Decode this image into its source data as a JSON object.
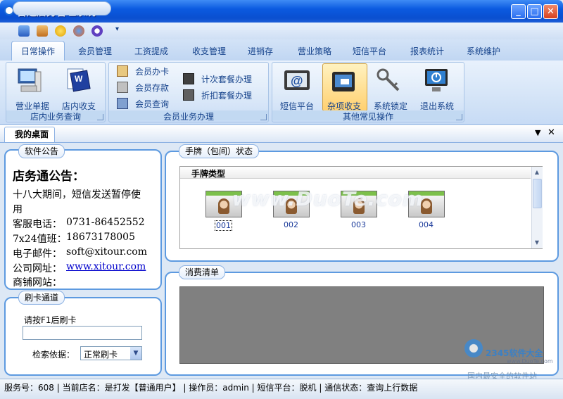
{
  "window": {
    "title": "喜途店务管理系统",
    "min": "_",
    "max": "□",
    "close": "✕"
  },
  "qat_icons": [
    "book-icon",
    "pen-icon",
    "smile-icon",
    "firefox-icon",
    "circle-icon"
  ],
  "tabs": [
    "日常操作",
    "会员管理",
    "工资提成",
    "收支管理",
    "进销存",
    "营业策略",
    "短信平台",
    "报表统计",
    "系统维护"
  ],
  "ribbon": {
    "group1": {
      "label": "店内业务查询",
      "buttons": [
        "营业单据",
        "店内收支"
      ]
    },
    "group2": {
      "label": "会员业务办理",
      "col1": [
        "会员办卡",
        "会员存款",
        "会员查询"
      ],
      "col2": [
        "计次套餐办理",
        "折扣套餐办理"
      ]
    },
    "group3": {
      "label": "其他常见操作",
      "buttons": [
        "短信平台",
        "杂项收支",
        "系统锁定",
        "退出系统"
      ]
    }
  },
  "desk_tab": "我的桌面",
  "notice_panel": {
    "title": "软件公告",
    "heading": "店务通公告：",
    "line1": "十八大期间，短信发送暂停使",
    "line2": "用",
    "phone_label": "客服电话：",
    "phone": "0731-86452552",
    "duty_label": "7x24值班：",
    "duty": "18673178005",
    "email_label": "电子邮件：",
    "email": "soft@xitour.com",
    "site_label": "公司网址：",
    "site": "www.xitour.com",
    "shop_label": "商铺网站："
  },
  "card_panel": {
    "title": "刷卡通道",
    "prompt": "请按F1后刷卡",
    "input_value": "",
    "search_label": "检索依据：",
    "search_value": "正常刷卡"
  },
  "room_panel": {
    "title": "手牌（包间）状态",
    "type_header": "手牌类型",
    "rooms": [
      "001",
      "002",
      "003",
      "004"
    ]
  },
  "consume_panel": {
    "title": "消费清单"
  },
  "status": {
    "text": "服务号：608 | 当前店名：是打发【普通用户】 | 操作员：admin | 短信平台：脱机 | 通信状态：查询上行数据"
  },
  "watermark": {
    "text": "www.DuoTe.com",
    "logo": "2345软件大全",
    "logo_url": "www.DuoTe.com",
    "slogan": "国内最安全的软件站"
  },
  "colors": {
    "titlebar": "#0b5ae0",
    "panel_border": "#5d9ae0",
    "consume_bg": "#808080",
    "tab_text": "#15428b"
  }
}
